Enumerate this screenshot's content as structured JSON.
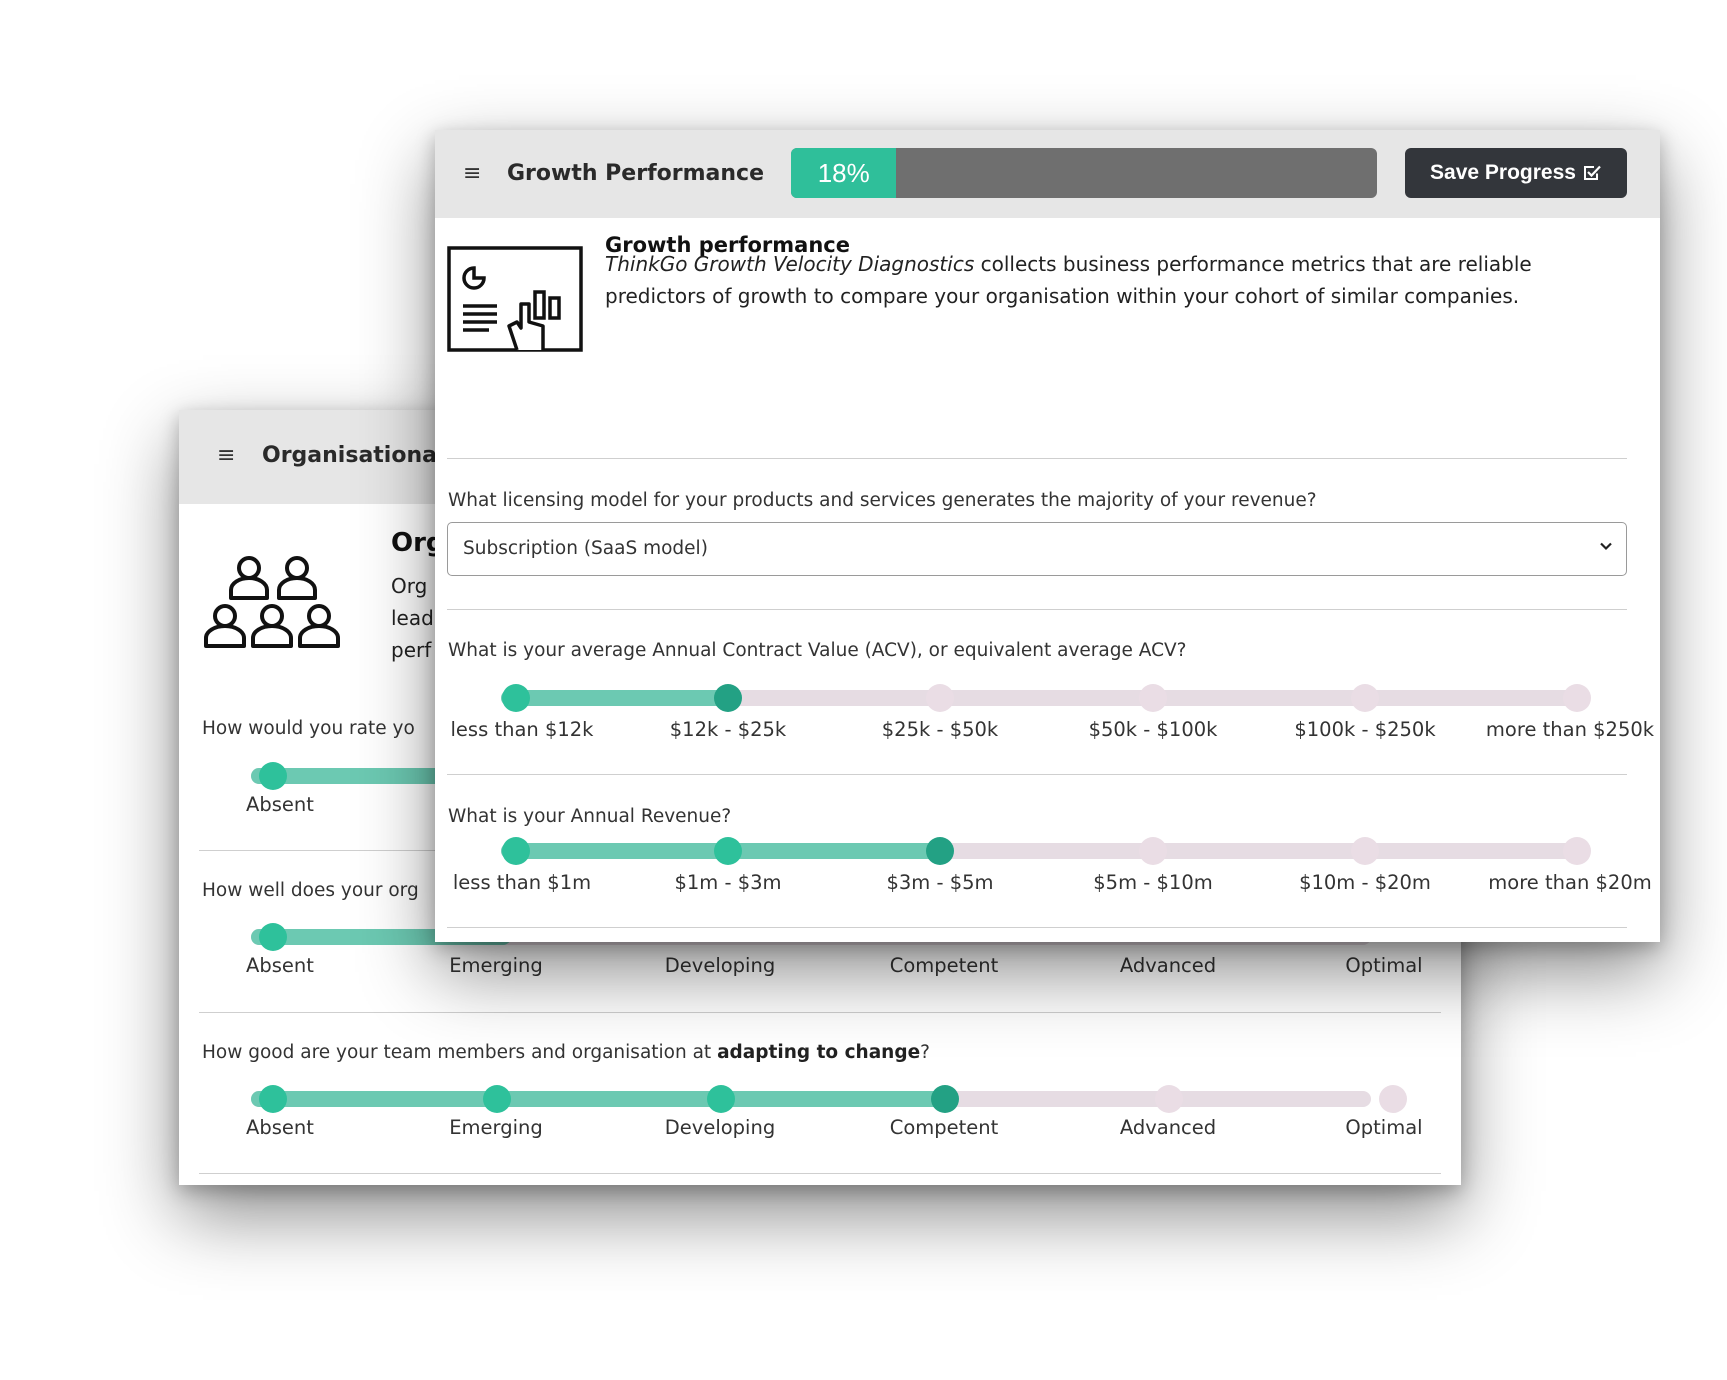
{
  "back_panel": {
    "title": "Organisational",
    "section_title": "Org",
    "desc_lines": [
      "Org",
      "lead",
      "perf"
    ],
    "q1": "How would you rate yo",
    "q2": "How well does your org",
    "q3": {
      "prefix": "How good are your team members and organisation at ",
      "bold": "adapting to change",
      "suffix": "?"
    },
    "levels": [
      "Absent",
      "Emerging",
      "Developing",
      "Competent",
      "Advanced",
      "Optimal"
    ],
    "q3_selected_index": 3
  },
  "front_panel": {
    "title": "Growth Performance",
    "progress": {
      "percent": 18,
      "label": "18%"
    },
    "save_button": "Save Progress",
    "section_title": "Growth performance",
    "desc": {
      "italic": "ThinkGo Growth Velocity Diagnostics",
      "rest": " collects business performance metrics that are reliable predictors of growth to compare your organisation within your cohort of similar companies."
    },
    "q_licensing": "What licensing model for your products and services generates the majority of your revenue?",
    "licensing_value": "Subscription (SaaS model)",
    "q_acv": "What is your average Annual Contract Value (ACV), or equivalent average ACV?",
    "acv_options": [
      "less than $12k",
      "$12k - $25k",
      "$25k - $50k",
      "$50k - $100k",
      "$100k - $250k",
      "more than $250k"
    ],
    "acv_selected_index": 1,
    "q_revenue": "What is your Annual Revenue?",
    "revenue_options": [
      "less than $1m",
      "$1m - $3m",
      "$3m - $5m",
      "$5m - $10m",
      "$10m - $20m",
      "more than $20m"
    ],
    "revenue_selected_index": 2
  },
  "colors": {
    "accent": "#2ec19b",
    "accent_dark": "#23a184",
    "track_fill": "#6cc9b2",
    "track_empty": "#e6dce3",
    "button_bg": "#33363b"
  },
  "icons": [
    "menu-icon",
    "presentation-icon",
    "team-icon",
    "check-square-icon",
    "chevron-down-icon"
  ]
}
